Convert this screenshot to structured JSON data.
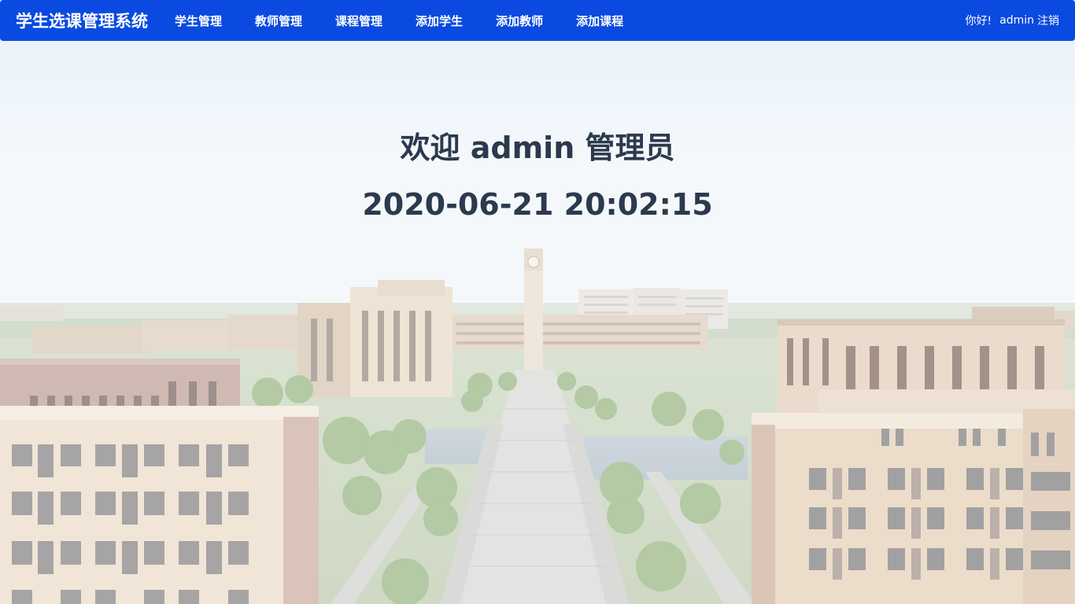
{
  "navbar": {
    "brand": "学生选课管理系统",
    "links": [
      {
        "label": "学生管理"
      },
      {
        "label": "教师管理"
      },
      {
        "label": "课程管理"
      },
      {
        "label": "添加学生"
      },
      {
        "label": "添加教师"
      },
      {
        "label": "添加课程"
      }
    ],
    "greeting": "你好!",
    "username": "admin",
    "logout": "注销"
  },
  "hero": {
    "welcome": "欢迎 admin 管理员",
    "datetime": "2020-06-21 20:02:15"
  },
  "colors": {
    "navbar": "#0a4ae0",
    "heading_text": "#2b3a4d"
  }
}
